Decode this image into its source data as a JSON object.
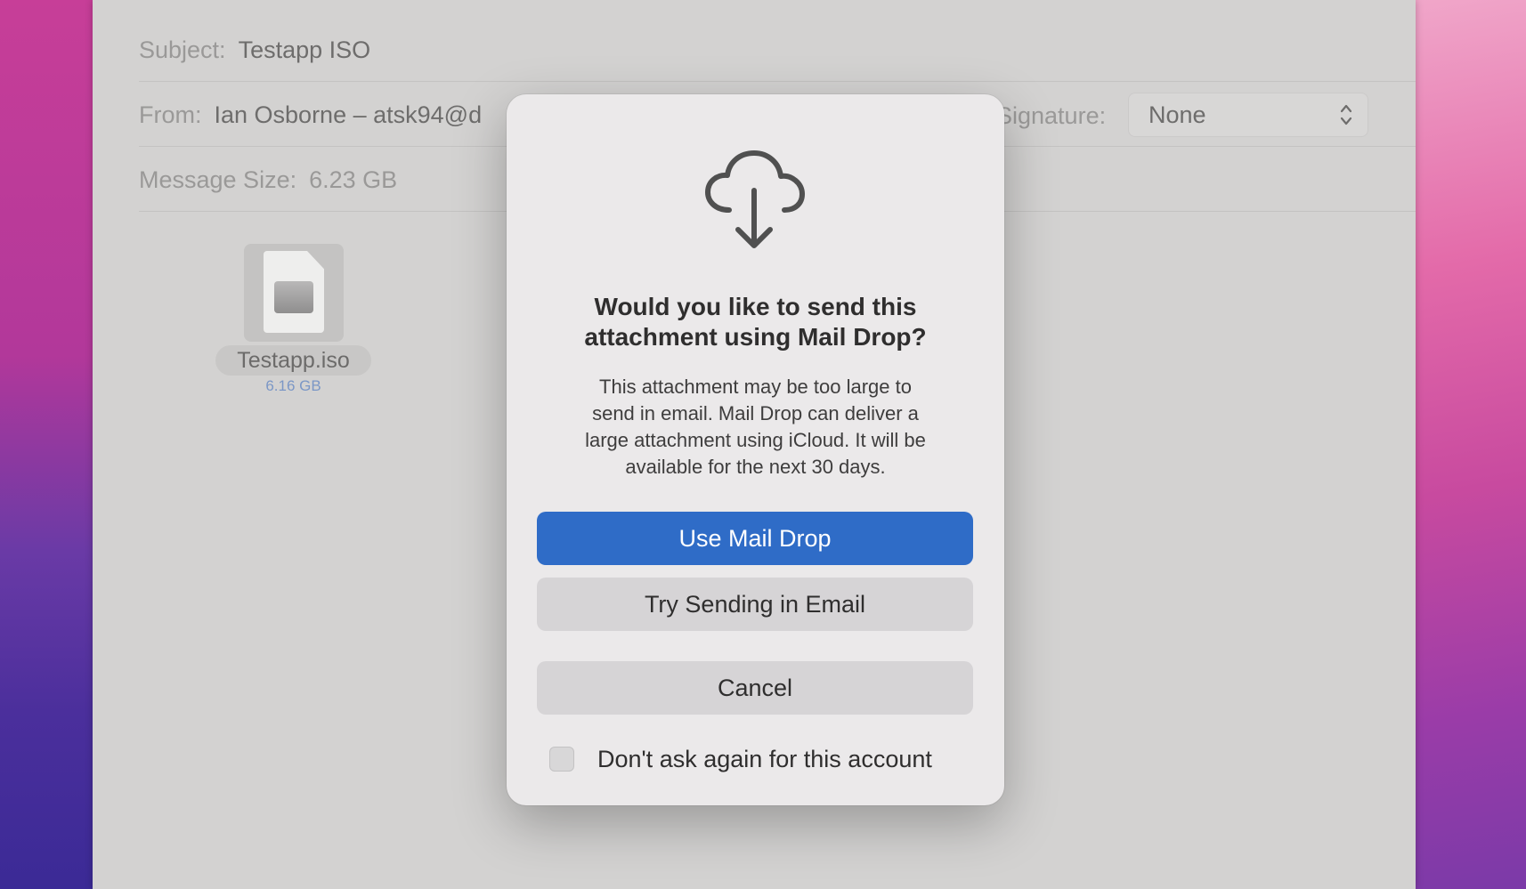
{
  "compose": {
    "subject_label": "Subject:",
    "subject_value": "Testapp ISO",
    "from_label": "From:",
    "from_value": "Ian Osborne – atsk94@d",
    "size_label": "Message Size:",
    "size_value": "6.23 GB",
    "signature_label": "Signature:",
    "signature_value": "None",
    "signature_icon": "chevron-updown-icon"
  },
  "attachment": {
    "name": "Testapp.iso",
    "size": "6.16 GB",
    "icon": "disk-image-icon"
  },
  "dialog": {
    "icon": "icloud-download-icon",
    "title_line1": "Would you like to send this",
    "title_line2": "attachment using Mail Drop?",
    "body_line1": "This attachment may be too large to",
    "body_line2": "send in email. Mail Drop can deliver a",
    "body_line3": "large attachment using iCloud. It will be",
    "body_line4": "available for the next 30 days.",
    "primary_button": "Use Mail Drop",
    "secondary_button": "Try Sending in Email",
    "cancel_button": "Cancel",
    "checkbox_label": "Don't ask again for this account",
    "checkbox_checked": false
  },
  "colors": {
    "accent": "#2f6cc7",
    "window_bg": "#d3d2d1",
    "dialog_bg": "#ebe9ea"
  }
}
